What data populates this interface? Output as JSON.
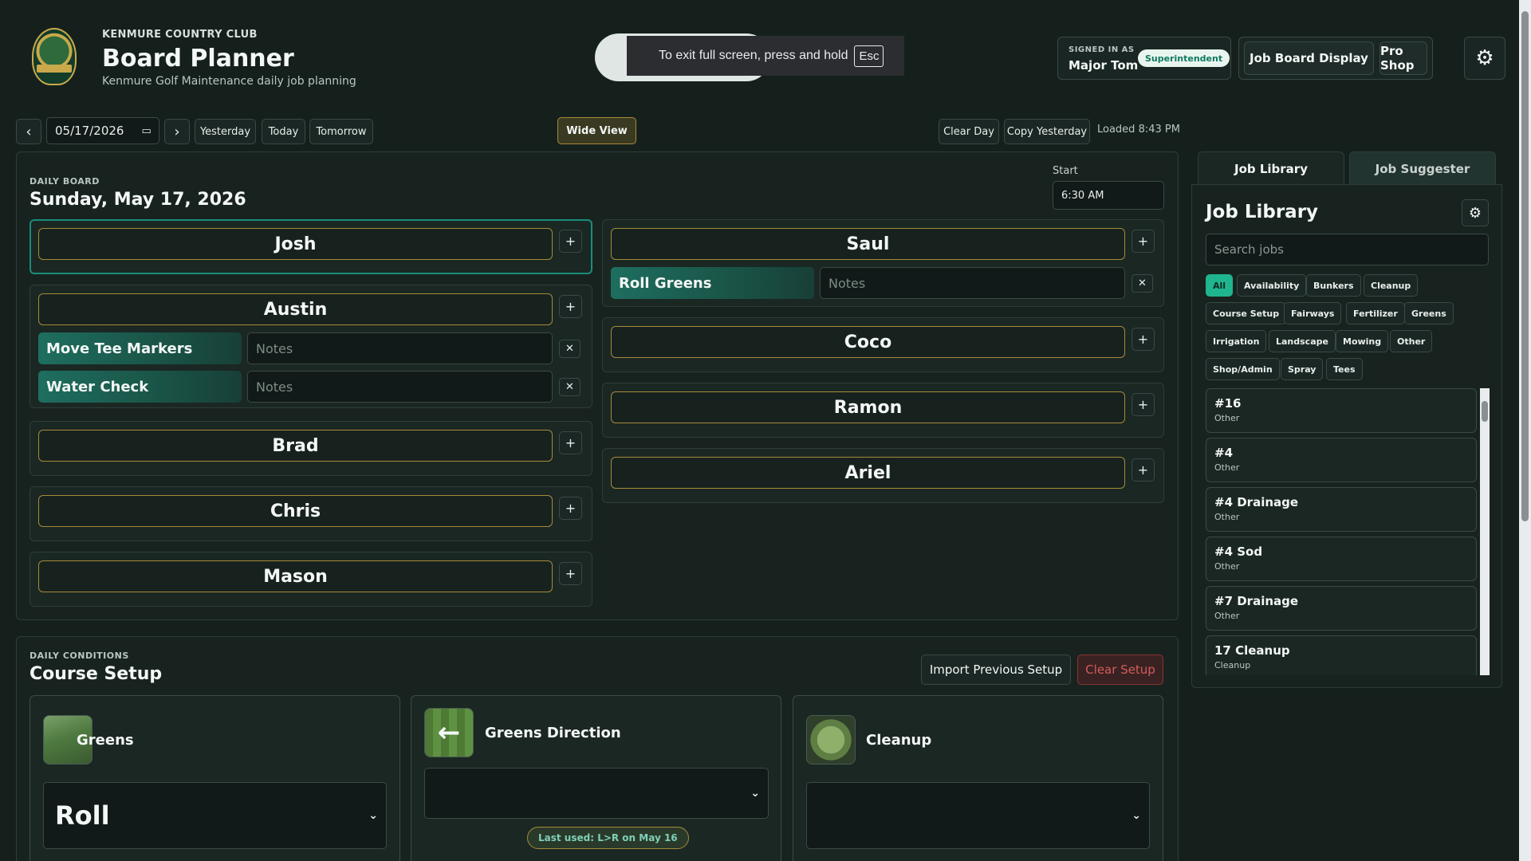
{
  "header": {
    "club_name": "KENMURE COUNTRY CLUB",
    "title": "Board Planner",
    "subtitle": "Kenmure Golf Maintenance daily job planning",
    "logo_icon": "club-crest-logo",
    "signed_in_label": "SIGNED IN AS",
    "user_name": "Major Tom",
    "role": "Superintendent",
    "nav": [
      "Job Board Display",
      "Pro Shop"
    ],
    "settings_icon": "gear-icon"
  },
  "fullscreen_toast": {
    "text": "To exit full screen, press and hold",
    "key": "Esc"
  },
  "toolbar": {
    "prev": "‹",
    "next": "›",
    "date": "05/17/2026",
    "calendar_icon": "calendar-icon",
    "yesterday": "Yesterday",
    "today": "Today",
    "tomorrow": "Tomorrow",
    "wide_view": "Wide View",
    "clear_day": "Clear Day",
    "copy_yesterday": "Copy Yesterday",
    "loaded": "Loaded 8:43 PM"
  },
  "board": {
    "label": "DAILY BOARD",
    "date_title": "Sunday, May 17, 2026",
    "start_label": "Start",
    "start_value": "6:30 AM",
    "notes_placeholder": "Notes",
    "left_column": [
      {
        "name": "Josh",
        "selected": true,
        "jobs": []
      },
      {
        "name": "Austin",
        "jobs": [
          {
            "job": "Move Tee Markers",
            "notes": ""
          },
          {
            "job": "Water Check",
            "notes": ""
          }
        ]
      },
      {
        "name": "Brad",
        "jobs": []
      },
      {
        "name": "Chris",
        "jobs": []
      },
      {
        "name": "Mason",
        "jobs": []
      }
    ],
    "right_column": [
      {
        "name": "Saul",
        "jobs": [
          {
            "job": "Roll Greens",
            "notes": ""
          }
        ]
      },
      {
        "name": "Coco",
        "jobs": []
      },
      {
        "name": "Ramon",
        "jobs": []
      },
      {
        "name": "Ariel",
        "jobs": []
      }
    ]
  },
  "course_setup": {
    "label": "DAILY CONDITIONS",
    "title": "Course Setup",
    "import_btn": "Import Previous Setup",
    "clear_btn": "Clear Setup",
    "cards": [
      {
        "title": "Greens",
        "value": "Roll",
        "icon": "greens-photo-icon"
      },
      {
        "title": "Greens Direction",
        "value": "",
        "icon": "left-arrow-stripes-icon",
        "last_used": "Last used: L>R on May 16"
      },
      {
        "title": "Cleanup",
        "value": "",
        "icon": "cleanup-green-icon"
      }
    ]
  },
  "library": {
    "tabs": [
      "Job Library",
      "Job Suggester"
    ],
    "active_tab": "Job Library",
    "title": "Job Library",
    "search_placeholder": "Search jobs",
    "filters": [
      "All",
      "Availability",
      "Bunkers",
      "Cleanup",
      "Course Setup",
      "Fairways",
      "Fertilizer",
      "Greens",
      "Irrigation",
      "Landscape",
      "Mowing",
      "Other",
      "Shop/Admin",
      "Spray",
      "Tees"
    ],
    "active_filter": "All",
    "items": [
      {
        "name": "#16",
        "category": "Other"
      },
      {
        "name": "#4",
        "category": "Other"
      },
      {
        "name": "#4 Drainage",
        "category": "Other"
      },
      {
        "name": "#4 Sod",
        "category": "Other"
      },
      {
        "name": "#7 Drainage",
        "category": "Other"
      },
      {
        "name": "17 Cleanup",
        "category": "Cleanup"
      }
    ]
  },
  "colors": {
    "background": "#15201d",
    "accent_teal": "#1a8c7d",
    "gold_border": "#a78a3a",
    "active_filter": "#1fb58f",
    "danger": "#d25b5b"
  }
}
